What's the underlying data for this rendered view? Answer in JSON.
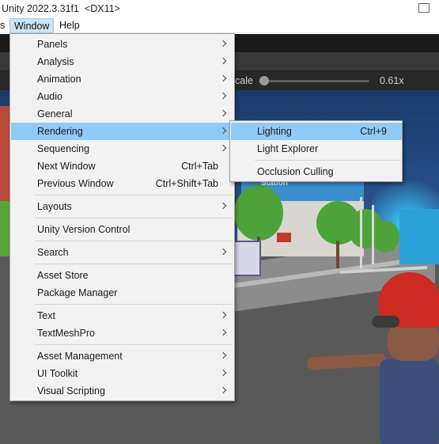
{
  "window": {
    "title": "Unity 2022.3.31f1  <DX11>"
  },
  "menubar": {
    "items": [
      {
        "label": "s"
      },
      {
        "label": "Window",
        "active": true
      },
      {
        "label": "Help"
      }
    ]
  },
  "scene_toolbar": {
    "scale_label": "cale",
    "scale_value": "0.61x",
    "scale_slider_fraction": 0.05
  },
  "window_menu": {
    "items": [
      {
        "label": "Panels",
        "submenu": true
      },
      {
        "label": "Analysis",
        "submenu": true
      },
      {
        "label": "Animation",
        "submenu": true
      },
      {
        "label": "Audio",
        "submenu": true
      },
      {
        "label": "General",
        "submenu": true
      },
      {
        "label": "Rendering",
        "submenu": true,
        "highlighted": true
      },
      {
        "label": "Sequencing",
        "submenu": true
      },
      {
        "label": "Next Window",
        "shortcut": "Ctrl+Tab"
      },
      {
        "label": "Previous Window",
        "shortcut": "Ctrl+Shift+Tab"
      },
      {
        "label": "Layouts",
        "submenu": true
      },
      {
        "label": "Unity Version Control"
      },
      {
        "label": "Search",
        "submenu": true
      },
      {
        "label": "Asset Store"
      },
      {
        "label": "Package Manager"
      },
      {
        "label": "Text",
        "submenu": true
      },
      {
        "label": "TextMeshPro",
        "submenu": true
      },
      {
        "label": "Asset Management",
        "submenu": true
      },
      {
        "label": "UI Toolkit",
        "submenu": true
      },
      {
        "label": "Visual Scripting",
        "submenu": true
      }
    ]
  },
  "rendering_submenu": {
    "items": [
      {
        "label": "Lighting",
        "shortcut": "Ctrl+9",
        "highlighted": true
      },
      {
        "label": "Light Explorer"
      },
      {
        "label": "Occlusion Culling"
      }
    ]
  },
  "scene": {
    "station_sign": "Station"
  },
  "colors": {
    "menu_background": "#f2f2f2",
    "menu_highlight": "#91c9f7",
    "menubar_active": "#cce4f7",
    "editor_dark": "#191919"
  },
  "icons": {
    "submenu_arrow": "chevron-right-icon"
  }
}
